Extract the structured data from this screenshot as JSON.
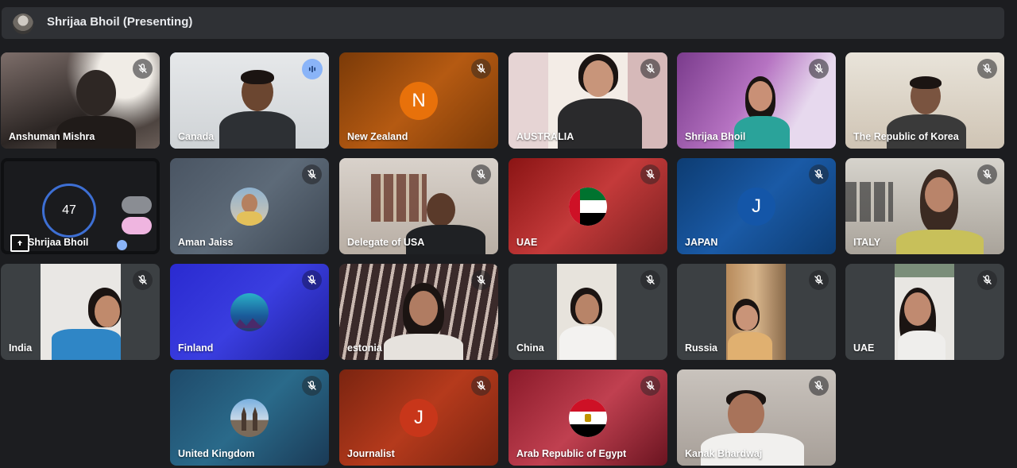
{
  "presenter_bar": {
    "name": "Shrijaa Bhoil (Presenting)"
  },
  "tiles": {
    "t1": {
      "name": "Anshuman Mishra"
    },
    "t2": {
      "name": "Canada"
    },
    "t3": {
      "name": "New Zealand",
      "initial": "N",
      "color": "#e8710a"
    },
    "t4": {
      "name": "AUSTRALIA"
    },
    "t5": {
      "name": "Shrijaa Bhoil"
    },
    "t6": {
      "name": "The Republic of Korea"
    },
    "t7": {
      "name": "Shrijaa Bhoil",
      "timer_value": "47"
    },
    "t8": {
      "name": "Aman Jaiss"
    },
    "t9": {
      "name": "Delegate of USA"
    },
    "t10": {
      "name": "UAE"
    },
    "t11": {
      "name": "JAPAN",
      "initial": "J",
      "color": "#1a73e8"
    },
    "t12": {
      "name": "ITALY"
    },
    "t13": {
      "name": "India"
    },
    "t14": {
      "name": "Finland"
    },
    "t15": {
      "name": "estonia"
    },
    "t16": {
      "name": "China"
    },
    "t17": {
      "name": "Russia"
    },
    "t18": {
      "name": "UAE"
    },
    "t19": {
      "name": "United Kingdom"
    },
    "t20": {
      "name": "Journalist",
      "initial": "J",
      "color": "#d93025"
    },
    "t21": {
      "name": "Arab Republic of Egypt"
    },
    "t22": {
      "name": "Kanak Bhardwaj"
    }
  }
}
